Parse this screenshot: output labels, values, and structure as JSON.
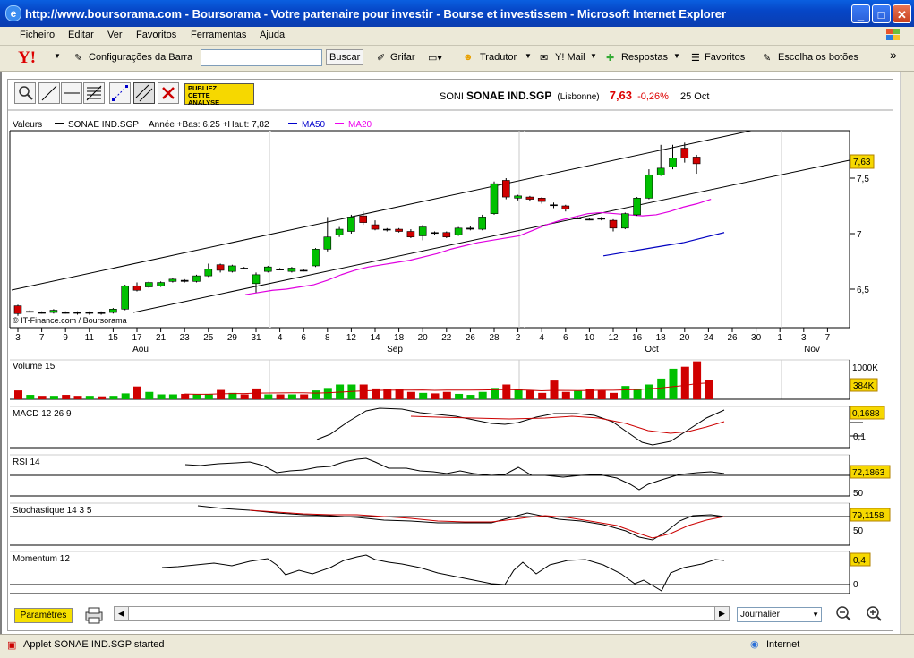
{
  "window": {
    "title": "http://www.boursorama.com - Boursorama - Votre partenaire pour investir - Bourse et investissem - Microsoft Internet Explorer"
  },
  "menu": [
    "Ficheiro",
    "Editar",
    "Ver",
    "Favoritos",
    "Ferramentas",
    "Ajuda"
  ],
  "toolbar": {
    "yahoo": "Y!",
    "config": "Configurações da Barra",
    "search_value": "",
    "buscar": "Buscar",
    "grifar": "Grifar",
    "tradutor": "Tradutor",
    "mail": "Y! Mail",
    "respostas": "Respostas",
    "favoritos": "Favoritos",
    "botoes": "Escolha os botões",
    "more": "»"
  },
  "applet": {
    "publiez": [
      "PUBLIEZ",
      "CETTE",
      "ANALYSE"
    ],
    "quote": {
      "ticker": "SONI",
      "name": "SONAE IND.SGP",
      "market": "(Lisbonne)",
      "price": "7,63",
      "change": "-0,26%",
      "date": "25 Oct"
    },
    "legend": {
      "valeurs": "Valeurs",
      "series": "SONAE IND.SGP",
      "range": "Année +Bas: 6,25 +Haut: 7,82",
      "ma50": "MA50",
      "ma20": "MA20"
    },
    "credit": "© IT-Finance.com / Boursorama",
    "price_tag": "7,63",
    "x_ticks": [
      "3",
      "7",
      "9",
      "11",
      "15",
      "17",
      "21",
      "23",
      "25",
      "29",
      "31",
      "4",
      "6",
      "8",
      "12",
      "14",
      "18",
      "20",
      "22",
      "26",
      "28",
      "2",
      "4",
      "6",
      "10",
      "12",
      "16",
      "18",
      "20",
      "24",
      "26",
      "30",
      "1",
      "3",
      "7"
    ],
    "months": [
      "Aou",
      "Sep",
      "Oct",
      "Nov"
    ],
    "panels": {
      "volume": {
        "label": "Volume 15",
        "axis": [
          "1000K"
        ],
        "tag": "384K"
      },
      "macd": {
        "label": "MACD 12 26 9",
        "axis": [
          "0,1"
        ],
        "tag": "0,1688"
      },
      "rsi": {
        "label": "RSI 14",
        "axis": [
          "50"
        ],
        "tag": "72,1863"
      },
      "stoch": {
        "label": "Stochastique 14 3 5",
        "axis": [
          "50"
        ],
        "tag": "79,1158"
      },
      "momentum": {
        "label": "Momentum 12",
        "axis": [
          "0"
        ],
        "tag": "0,4"
      }
    },
    "parametres": "Paramètres",
    "period": "Journalier"
  },
  "status": {
    "text": "Applet SONAE IND.SGP started",
    "zone": "Internet"
  },
  "chart_data": {
    "type": "candlestick",
    "ylim": [
      6.25,
      7.82
    ],
    "y_ticks": [
      6.5,
      7,
      7.5
    ],
    "candles": [
      {
        "o": 6.35,
        "c": 6.28,
        "h": 6.36,
        "l": 6.26
      },
      {
        "o": 6.3,
        "c": 6.3,
        "h": 6.31,
        "l": 6.29
      },
      {
        "o": 6.29,
        "c": 6.29,
        "h": 6.3,
        "l": 6.28
      },
      {
        "o": 6.29,
        "c": 6.31,
        "h": 6.32,
        "l": 6.28
      },
      {
        "o": 6.29,
        "c": 6.29,
        "h": 6.3,
        "l": 6.28
      },
      {
        "o": 6.29,
        "c": 6.29,
        "h": 6.3,
        "l": 6.27
      },
      {
        "o": 6.29,
        "c": 6.29,
        "h": 6.3,
        "l": 6.27
      },
      {
        "o": 6.29,
        "c": 6.28,
        "h": 6.3,
        "l": 6.27
      },
      {
        "o": 6.29,
        "c": 6.32,
        "h": 6.33,
        "l": 6.28
      },
      {
        "o": 6.32,
        "c": 6.53,
        "h": 6.54,
        "l": 6.31
      },
      {
        "o": 6.53,
        "c": 6.49,
        "h": 6.56,
        "l": 6.48
      },
      {
        "o": 6.52,
        "c": 6.56,
        "h": 6.57,
        "l": 6.51
      },
      {
        "o": 6.53,
        "c": 6.56,
        "h": 6.57,
        "l": 6.52
      },
      {
        "o": 6.57,
        "c": 6.59,
        "h": 6.6,
        "l": 6.56
      },
      {
        "o": 6.57,
        "c": 6.58,
        "h": 6.59,
        "l": 6.56
      },
      {
        "o": 6.57,
        "c": 6.62,
        "h": 6.63,
        "l": 6.56
      },
      {
        "o": 6.62,
        "c": 6.68,
        "h": 6.73,
        "l": 6.61
      },
      {
        "o": 6.72,
        "c": 6.67,
        "h": 6.73,
        "l": 6.65
      },
      {
        "o": 6.66,
        "c": 6.71,
        "h": 6.72,
        "l": 6.65
      },
      {
        "o": 6.69,
        "c": 6.69,
        "h": 6.7,
        "l": 6.68
      },
      {
        "o": 6.55,
        "c": 6.63,
        "h": 6.65,
        "l": 6.47
      },
      {
        "o": 6.66,
        "c": 6.7,
        "h": 6.71,
        "l": 6.65
      },
      {
        "o": 6.68,
        "c": 6.68,
        "h": 6.69,
        "l": 6.67
      },
      {
        "o": 6.66,
        "c": 6.69,
        "h": 6.7,
        "l": 6.65
      },
      {
        "o": 6.67,
        "c": 6.67,
        "h": 6.68,
        "l": 6.66
      },
      {
        "o": 6.71,
        "c": 6.86,
        "h": 6.87,
        "l": 6.7
      },
      {
        "o": 6.86,
        "c": 6.97,
        "h": 7.15,
        "l": 6.84
      },
      {
        "o": 6.99,
        "c": 7.04,
        "h": 7.06,
        "l": 6.97
      },
      {
        "o": 7.02,
        "c": 7.15,
        "h": 7.17,
        "l": 7.0
      },
      {
        "o": 7.16,
        "c": 7.1,
        "h": 7.2,
        "l": 7.08
      },
      {
        "o": 7.08,
        "c": 7.04,
        "h": 7.12,
        "l": 7.03
      },
      {
        "o": 7.04,
        "c": 7.04,
        "h": 7.05,
        "l": 7.02
      },
      {
        "o": 7.04,
        "c": 7.02,
        "h": 7.05,
        "l": 7.01
      },
      {
        "o": 7.02,
        "c": 6.97,
        "h": 7.04,
        "l": 6.96
      },
      {
        "o": 6.98,
        "c": 7.06,
        "h": 7.08,
        "l": 6.94
      },
      {
        "o": 7.01,
        "c": 7.01,
        "h": 7.02,
        "l": 6.99
      },
      {
        "o": 7.01,
        "c": 6.97,
        "h": 7.02,
        "l": 6.96
      },
      {
        "o": 6.99,
        "c": 7.05,
        "h": 7.06,
        "l": 6.98
      },
      {
        "o": 7.04,
        "c": 7.05,
        "h": 7.07,
        "l": 7.03
      },
      {
        "o": 7.04,
        "c": 7.15,
        "h": 7.17,
        "l": 7.03
      },
      {
        "o": 7.18,
        "c": 7.45,
        "h": 7.47,
        "l": 7.17
      },
      {
        "o": 7.48,
        "c": 7.33,
        "h": 7.5,
        "l": 7.31
      },
      {
        "o": 7.32,
        "c": 7.34,
        "h": 7.35,
        "l": 7.3
      },
      {
        "o": 7.33,
        "c": 7.31,
        "h": 7.34,
        "l": 7.29
      },
      {
        "o": 7.32,
        "c": 7.29,
        "h": 7.33,
        "l": 7.27
      },
      {
        "o": 7.26,
        "c": 7.26,
        "h": 7.28,
        "l": 7.23
      },
      {
        "o": 7.25,
        "c": 7.22,
        "h": 7.26,
        "l": 7.2
      },
      {
        "o": 7.14,
        "c": 7.14,
        "h": 7.15,
        "l": 7.13
      },
      {
        "o": 7.13,
        "c": 7.13,
        "h": 7.14,
        "l": 7.12
      },
      {
        "o": 7.14,
        "c": 7.13,
        "h": 7.15,
        "l": 7.12
      },
      {
        "o": 7.12,
        "c": 7.05,
        "h": 7.13,
        "l": 7.02
      },
      {
        "o": 7.05,
        "c": 7.18,
        "h": 7.19,
        "l": 7.04
      },
      {
        "o": 7.17,
        "c": 7.32,
        "h": 7.33,
        "l": 7.16
      },
      {
        "o": 7.32,
        "c": 7.53,
        "h": 7.58,
        "l": 7.31
      },
      {
        "o": 7.53,
        "c": 7.59,
        "h": 7.8,
        "l": 7.52
      },
      {
        "o": 7.6,
        "c": 7.68,
        "h": 7.8,
        "l": 7.58
      },
      {
        "o": 7.77,
        "c": 7.68,
        "h": 7.82,
        "l": 7.64
      },
      {
        "o": 7.69,
        "c": 7.63,
        "h": 7.71,
        "l": 7.54
      }
    ],
    "upper_channel": [
      [
        6.48,
        7.82
      ]
    ],
    "lower_channel": [
      [
        6.27,
        7.67
      ]
    ],
    "ma20": [
      6.45,
      6.47,
      6.49,
      6.5,
      6.52,
      6.54,
      6.58,
      6.63,
      6.67,
      6.7,
      6.72,
      6.74,
      6.76,
      6.79,
      6.82,
      6.86,
      6.89,
      6.92,
      6.94,
      6.96,
      6.98,
      7.03,
      7.08,
      7.12,
      7.15,
      7.18,
      7.19,
      7.18,
      7.17,
      7.16,
      7.17,
      7.2,
      7.24,
      7.27,
      7.31
    ],
    "ma50": [
      6.8,
      6.82,
      6.84,
      6.86,
      6.88,
      6.9,
      6.92,
      6.95,
      6.98,
      7.01
    ],
    "volume_k": [
      180,
      90,
      70,
      70,
      90,
      70,
      70,
      60,
      70,
      120,
      260,
      150,
      100,
      100,
      110,
      100,
      110,
      190,
      130,
      100,
      220,
      100,
      100,
      100,
      100,
      180,
      230,
      300,
      300,
      300,
      220,
      200,
      210,
      150,
      130,
      120,
      150,
      110,
      90,
      150,
      230,
      300,
      210,
      180,
      130,
      380,
      150,
      170,
      200,
      180,
      130,
      270,
      210,
      300,
      420,
      620,
      660,
      770,
      384
    ],
    "up_flags": [
      0,
      1,
      0,
      1,
      0,
      0,
      1,
      0,
      1,
      1,
      0,
      1,
      1,
      1,
      0,
      1,
      1,
      0,
      1,
      0,
      0,
      1,
      0,
      1,
      0,
      1,
      1,
      1,
      1,
      0,
      0,
      0,
      0,
      0,
      1,
      0,
      0,
      1,
      1,
      1,
      1,
      0,
      1,
      0,
      0,
      0,
      0,
      1,
      0,
      0,
      0,
      1,
      1,
      1,
      1,
      1,
      0,
      0,
      0
    ]
  }
}
